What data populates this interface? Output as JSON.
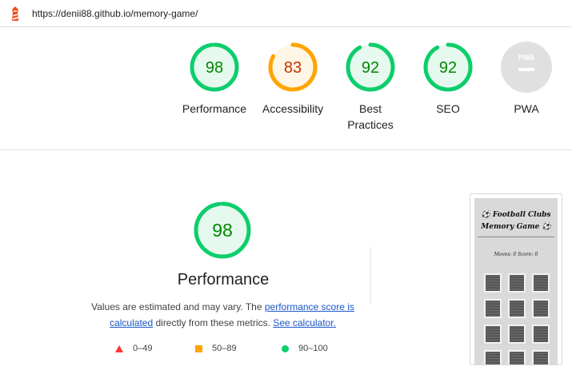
{
  "browser": {
    "url": "https://denii88.github.io/memory-game/",
    "icon": "lighthouse-icon"
  },
  "summary": {
    "gauges": [
      {
        "label": "Performance",
        "score": "98",
        "status": "pass",
        "fraction": 0.98
      },
      {
        "label": "Accessibility",
        "score": "83",
        "status": "average",
        "fraction": 0.83
      },
      {
        "label_line1": "Best",
        "label_line2": "Practices",
        "score": "92",
        "status": "pass",
        "fraction": 0.92
      },
      {
        "label": "SEO",
        "score": "92",
        "status": "pass",
        "fraction": 0.92
      },
      {
        "label": "PWA",
        "badge_text": "PWA",
        "status": "na"
      }
    ]
  },
  "performance": {
    "score": "98",
    "fraction": 0.98,
    "title": "Performance",
    "note_prefix": "Values are estimated and may vary. The ",
    "note_link1": "performance score is calculated",
    "note_middle": " directly from these metrics. ",
    "note_link2": "See calculator."
  },
  "legend": [
    {
      "shape": "triangle",
      "range": "0–49",
      "color": "#ff3333"
    },
    {
      "shape": "square",
      "range": "50–89",
      "color": "#ffa400"
    },
    {
      "shape": "circle",
      "range": "90–100",
      "color": "#0cce6b"
    }
  ],
  "screenshot": {
    "title_line1": "Football Clubs",
    "title_line2": "Memory Game",
    "stats": "Moves: 0 Score: 0"
  },
  "colors": {
    "pass": "#0cce6b",
    "pass_text": "#008800",
    "pass_fill": "#e6f9ee",
    "average": "#ffa400",
    "average_text": "#c33300",
    "average_fill": "#fff6e5",
    "na": "#e0e0e0"
  }
}
